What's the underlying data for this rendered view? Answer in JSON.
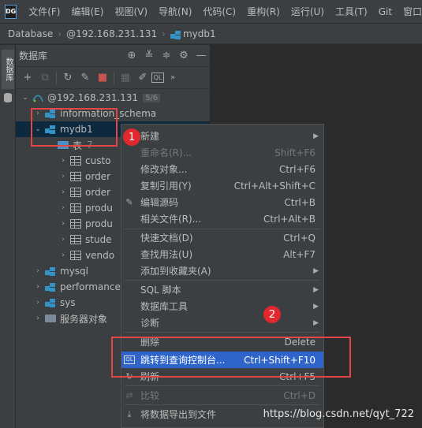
{
  "app": {
    "logo": "DG"
  },
  "menubar": {
    "items": [
      "文件(F)",
      "编辑(E)",
      "视图(V)",
      "导航(N)",
      "代码(C)",
      "重构(R)",
      "运行(U)",
      "工具(T)",
      "Git",
      "窗口(W)"
    ]
  },
  "breadcrumb": {
    "items": [
      "Database",
      "@192.168.231.131",
      "mydb1"
    ]
  },
  "toolstrip": {
    "tab_label": "数据库"
  },
  "panel": {
    "title": "数据库",
    "header_icons": [
      "globe-icon",
      "collapse-icon",
      "expand-icon",
      "gear-icon",
      "minimize-icon"
    ],
    "toolbar_icons": [
      "add-icon",
      "copy-icon",
      "refresh-icon",
      "properties-icon",
      "stop-icon",
      "grid-icon",
      "edit-icon",
      "console-icon",
      "more-icon"
    ]
  },
  "tree": {
    "host": {
      "label": "@192.168.231.131",
      "count": "5/6"
    },
    "schemas": {
      "information_schema": "information_schema",
      "mydb1": "mydb1",
      "tables_folder": "表",
      "tables_count": "7",
      "tables": [
        "custo",
        "order",
        "order",
        "produ",
        "produ",
        "stude",
        "vendo"
      ],
      "mysql": "mysql",
      "performance": "performance",
      "sys": "sys",
      "server_objects": "服务器对象"
    }
  },
  "context_menu": {
    "items": [
      {
        "label": "新建",
        "shortcut": "",
        "submenu": true,
        "disabled": false
      },
      {
        "label": "重命名(R)...",
        "shortcut": "Shift+F6",
        "submenu": false,
        "disabled": true
      },
      {
        "label": "修改对象...",
        "shortcut": "Ctrl+F6",
        "submenu": false,
        "disabled": false
      },
      {
        "label": "复制引用(Y)",
        "shortcut": "Ctrl+Alt+Shift+C",
        "submenu": false,
        "disabled": false
      },
      {
        "label": "编辑源码",
        "shortcut": "Ctrl+B",
        "submenu": false,
        "disabled": false
      },
      {
        "label": "相关文件(R)...",
        "shortcut": "Ctrl+Alt+B",
        "submenu": false,
        "disabled": false
      },
      {
        "label": "快速文档(D)",
        "shortcut": "Ctrl+Q",
        "submenu": false,
        "disabled": false
      },
      {
        "label": "查找用法(U)",
        "shortcut": "Alt+F7",
        "submenu": false,
        "disabled": false
      },
      {
        "label": "添加到收藏夹(A)",
        "shortcut": "",
        "submenu": true,
        "disabled": false
      },
      {
        "label": "SQL 脚本",
        "shortcut": "",
        "submenu": true,
        "disabled": false
      },
      {
        "label": "数据库工具",
        "shortcut": "",
        "submenu": true,
        "disabled": false
      },
      {
        "label": "诊断",
        "shortcut": "",
        "submenu": true,
        "disabled": false
      },
      {
        "label": "删除",
        "shortcut": "Delete",
        "submenu": false,
        "disabled": false
      },
      {
        "label": "跳转到查询控制台...",
        "shortcut": "Ctrl+Shift+F10",
        "submenu": false,
        "disabled": false
      },
      {
        "label": "刷新",
        "shortcut": "Ctrl+F5",
        "submenu": false,
        "disabled": false
      },
      {
        "label": "比较",
        "shortcut": "Ctrl+D",
        "submenu": false,
        "disabled": true
      },
      {
        "label": "将数据导出到文件",
        "shortcut": "",
        "submenu": false,
        "disabled": false
      }
    ]
  },
  "annotations": {
    "badge1": "1",
    "badge2": "2",
    "highlight_color": "#e64545"
  },
  "watermark": "https://blog.csdn.net/qyt_722"
}
